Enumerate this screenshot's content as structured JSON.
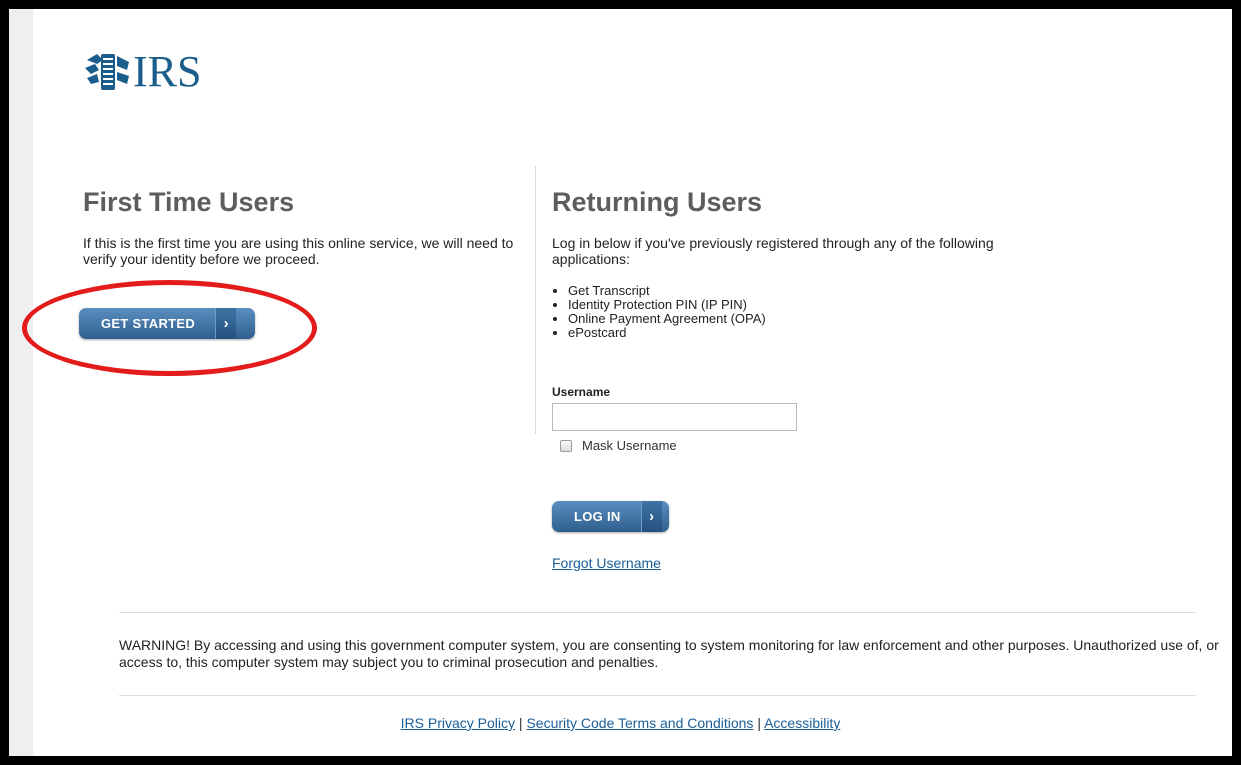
{
  "logo": {
    "text": "IRS",
    "emblem_icon": "irs-eagle-emblem-icon"
  },
  "first_time": {
    "heading": "First Time Users",
    "intro": "If this is the first time you are using this online service, we will need to verify your identity before we proceed.",
    "button_label": "GET STARTED",
    "button_icon": "chevron-right-icon"
  },
  "returning": {
    "heading": "Returning Users",
    "intro": "Log in below if you've previously registered through any of the following applications:",
    "apps": [
      "Get Transcript",
      "Identity Protection PIN (IP PIN)",
      "Online Payment Agreement (OPA)",
      "ePostcard"
    ],
    "username_label": "Username",
    "username_value": "",
    "mask_label": "Mask Username",
    "mask_checked": false,
    "login_label": "LOG IN",
    "forgot_label": "Forgot Username"
  },
  "warning": "WARNING! By accessing and using this government computer system, you are consenting to system monitoring for law enforcement and other purposes. Unauthorized use of, or access to, this computer system may subject you to criminal prosecution and penalties.",
  "footer": {
    "links": [
      "IRS Privacy Policy",
      "Security Code Terms and Conditions",
      "Accessibility"
    ],
    "separator": "|"
  },
  "colors": {
    "brand": "#1b5e8c",
    "button": "#2e5f8e",
    "highlight": "#e31b1b",
    "link": "#1a5e98"
  }
}
